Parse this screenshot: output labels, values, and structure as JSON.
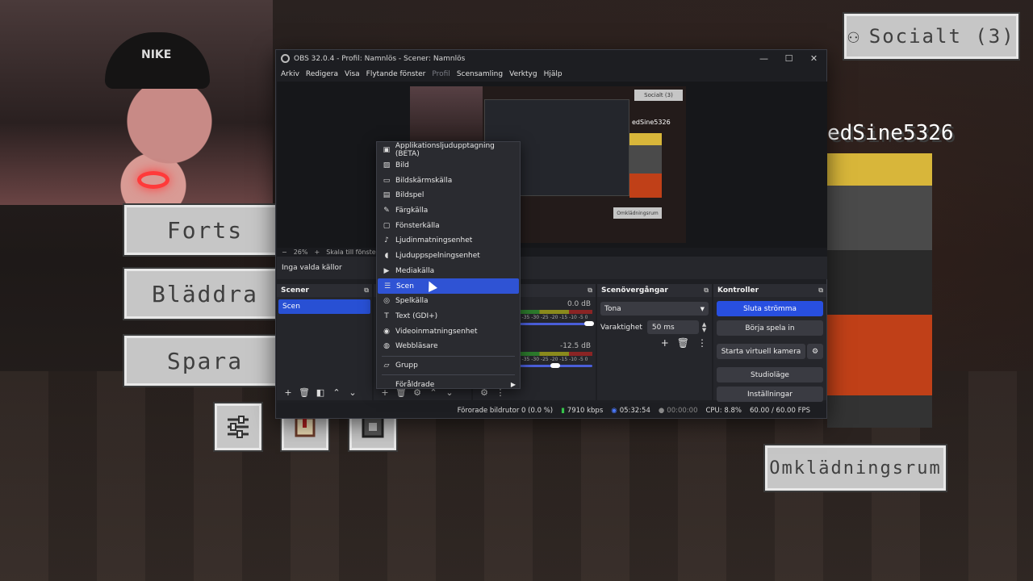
{
  "game": {
    "social_button": "Socialt (3)",
    "player_name": "edSine5326",
    "menu_buttons": [
      "Forts",
      "Bläddra",
      "Spara"
    ],
    "changing_room_button": "Omklädningsrum",
    "icon_buttons": [
      "sliders-icon",
      "book-icon",
      "screenshot-icon"
    ]
  },
  "webcam": {
    "cap_logo": "NIKE"
  },
  "obs": {
    "title": "OBS 32.0.4 - Profil: Namnlös - Scener: Namnlös",
    "menu": [
      "Arkiv",
      "Redigera",
      "Visa",
      "Flytande fönster",
      "Profil",
      "Scensamling",
      "Verktyg",
      "Hjälp"
    ],
    "preview": {
      "social": "Socialt (3)",
      "name": "edSine5326",
      "changing_room": "Omklädningsrum"
    },
    "zoom": {
      "minus": "−",
      "value": "26%",
      "plus": "+",
      "fit": "Skala till fönster"
    },
    "no_source": "Inga valda källor",
    "scenes": {
      "title": "Scener",
      "items": [
        "Scen"
      ]
    },
    "mixer": {
      "channel1_db": "0.0 dB",
      "channel2_db": "-12.5 dB",
      "scale": "-60 -55 -50 -45 -40 -35 -30 -25 -20 -15 -10 -5 0"
    },
    "transitions": {
      "title": "Scenövergångar",
      "selected": "Tona",
      "duration_label": "Varaktighet",
      "duration": "50 ms"
    },
    "controls": {
      "title": "Kontroller",
      "buttons": [
        "Sluta strömma",
        "Börja spela in",
        "Starta virtuell kamera",
        "Studioläge",
        "Inställningar"
      ]
    },
    "status": {
      "dropped": "Förorade bildrutor 0 (0.0 %)",
      "bitrate": "7910 kbps",
      "stream_time": "05:32:54",
      "rec_time": "00:00:00",
      "cpu": "CPU: 8.8%",
      "fps": "60.00 / 60.00 FPS"
    }
  },
  "context_menu": {
    "items": [
      {
        "label": "Applikationsljudupptagning (BETA)",
        "icon": "app-audio-icon"
      },
      {
        "label": "Bild",
        "icon": "image-icon"
      },
      {
        "label": "Bildskärmskälla",
        "icon": "monitor-icon"
      },
      {
        "label": "Bildspel",
        "icon": "slideshow-icon"
      },
      {
        "label": "Färgkälla",
        "icon": "brush-icon"
      },
      {
        "label": "Fönsterkälla",
        "icon": "window-icon"
      },
      {
        "label": "Ljudinmatningsenhet",
        "icon": "microphone-icon"
      },
      {
        "label": "Ljuduppspelningsenhet",
        "icon": "speaker-icon"
      },
      {
        "label": "Mediakälla",
        "icon": "play-icon"
      },
      {
        "label": "Scen",
        "icon": "list-icon",
        "selected": true
      },
      {
        "label": "Spelkälla",
        "icon": "gamepad-icon"
      },
      {
        "label": "Text (GDI+)",
        "icon": "text-icon"
      },
      {
        "label": "Videoinmatningsenhet",
        "icon": "camera-icon"
      },
      {
        "label": "Webbläsare",
        "icon": "globe-icon"
      },
      {
        "label": "Grupp",
        "icon": "folder-icon"
      },
      {
        "label": "Föråldrade",
        "icon": "none"
      }
    ]
  }
}
